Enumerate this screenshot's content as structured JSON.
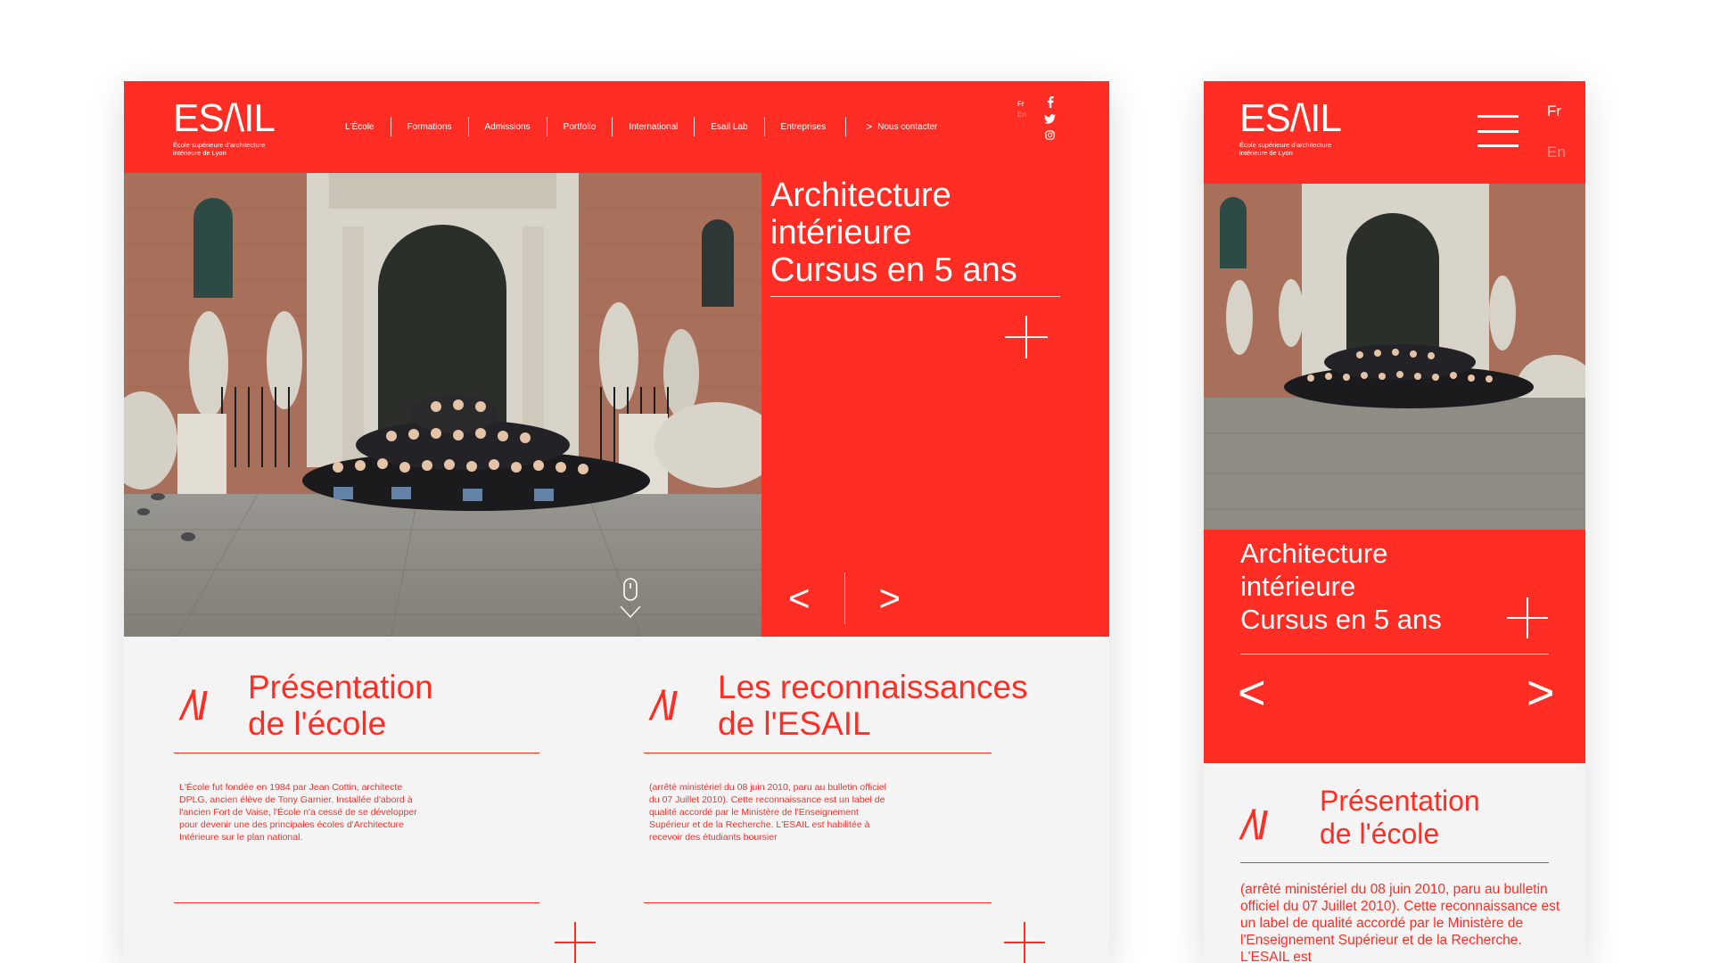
{
  "brand": {
    "logo": "ES/\\IL",
    "tagline": "École supérieure d'architecture intérieure de Lyon",
    "accent": "#ff2d24"
  },
  "nav": {
    "items": [
      "L'École",
      "Formations",
      "Admissions",
      "Portfolio",
      "International",
      "Esail Lab",
      "Entreprises"
    ],
    "contact": "Nous contacter"
  },
  "lang": {
    "fr": "Fr",
    "en": "En"
  },
  "social": [
    "facebook-icon",
    "twitter-icon",
    "instagram-icon"
  ],
  "hero": {
    "line1": "Architecture",
    "line2": "intérieure",
    "line3": "Cursus en 5 ans",
    "prev": "<",
    "next": ">"
  },
  "cards": [
    {
      "mark": "/\\I",
      "title1": "Présentation",
      "title2": "de l'école",
      "body": "L'École fut fondée en 1984 par Jean Cottin, architecte DPLG, ancien élève de Tony Garnier. Installée d'abord à l'ancien Fort de Vaise, l'École n'a cessé de se développer pour devenir une des principales écoles d'Architecture Intérieure sur le plan national."
    },
    {
      "mark": "/\\I",
      "title1": "Les reconnaissances",
      "title2": "de l'ESAIL",
      "body": "(arrêté ministériel du 08 juin 2010, paru au bulletin officiel du 07 Juillet 2010). Cette reconnaissance est un label de qualité accordé par le Ministère de l'Enseignement Supérieur et de la Recherche. L'ESAIL est habilitée à recevoir des étudiants boursier"
    }
  ],
  "mobile": {
    "card_body": "(arrêté ministériel du 08 juin 2010, paru au bulletin officiel du 07 Juillet 2010). Cette reconnaissance est un label de qualité accordé par le Ministère de l'Enseignement Supérieur et de la Recherche. L'ESAIL est"
  }
}
